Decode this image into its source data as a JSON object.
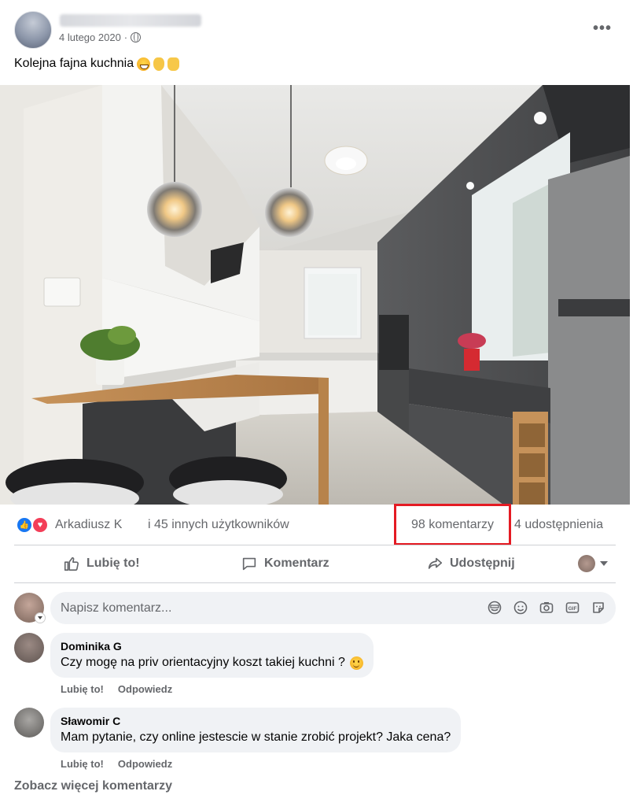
{
  "post": {
    "date": "4 lutego 2020",
    "date_separator": "·",
    "text": "Kolejna fajna kuchnia",
    "emoji_names": [
      "grin-icon",
      "ok-hand-icon",
      "thumbs-up-icon"
    ]
  },
  "reactions": {
    "first_name": "Arkadiusz K",
    "others": "i 45 innych użytkowników",
    "comments_count": "98 komentarzy",
    "shares_count": "4 udostępnienia",
    "highlight_color": "#e41b23"
  },
  "actions": {
    "like": "Lubię to!",
    "comment": "Komentarz",
    "share": "Udostępnij"
  },
  "composer": {
    "placeholder": "Napisz komentarz..."
  },
  "comments": [
    {
      "author": "Dominika G",
      "text": "Czy mogę na priv orientacyjny koszt takiej kuchni ?",
      "like": "Lubię to!",
      "reply": "Odpowiedz"
    },
    {
      "author": "Sławomir C",
      "text": "Mam pytanie, czy online jestescie w stanie zrobić projekt? Jaka cena?",
      "like": "Lubię to!",
      "reply": "Odpowiedz"
    }
  ],
  "more_comments": "Zobacz więcej komentarzy",
  "colors": {
    "like_blue": "#1877f2",
    "love_red": "#f33e58",
    "secondary_text": "#65676b",
    "bubble_bg": "#f0f2f5"
  }
}
